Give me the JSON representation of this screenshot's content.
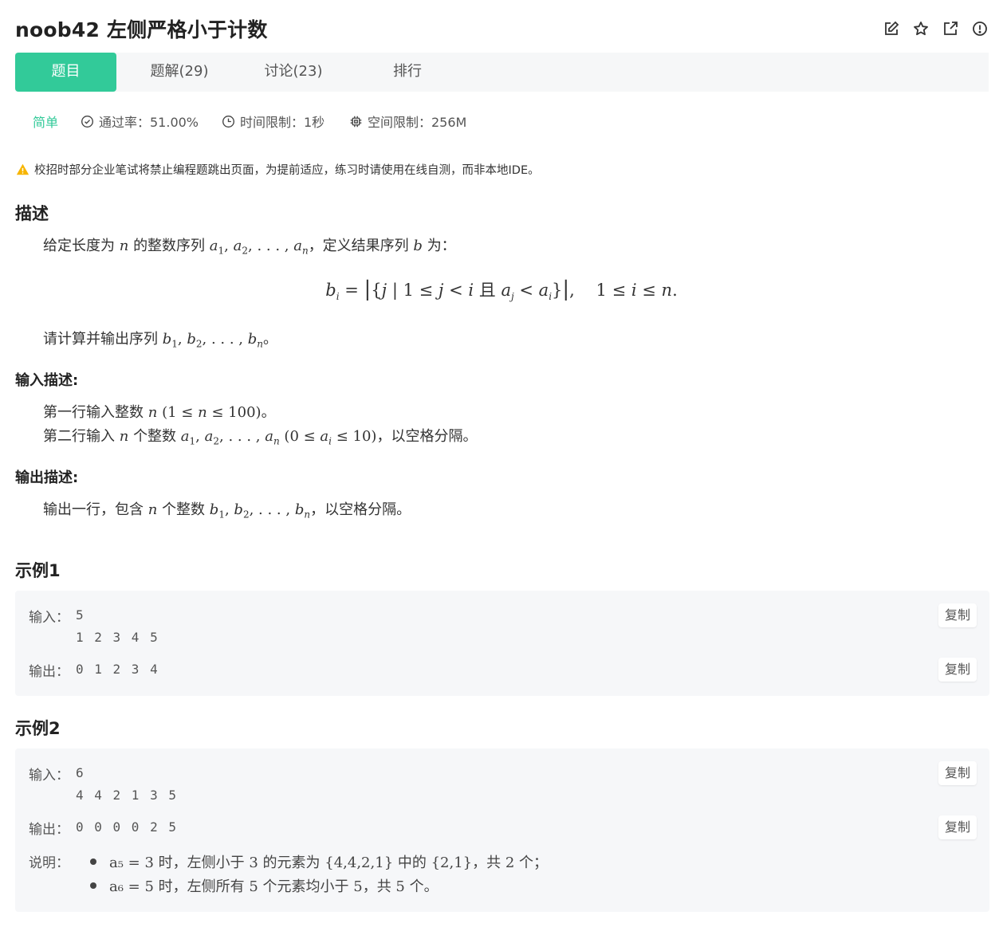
{
  "header": {
    "title": "noob42  左侧严格小于计数",
    "icons": [
      "edit-icon",
      "star-icon",
      "external-link-icon",
      "report-icon"
    ]
  },
  "tabs": [
    {
      "label": "题目",
      "active": true
    },
    {
      "label": "题解(29)"
    },
    {
      "label": "讨论(23)"
    },
    {
      "label": "排行"
    }
  ],
  "meta": {
    "difficulty": "简单",
    "pass_rate": "通过率：51.00%",
    "time_limit": "时间限制：1秒",
    "space_limit": "空间限制：256M"
  },
  "warning": "校招时部分企业笔试将禁止编程题跳出页面，为提前适应，练习时请使用在线自测，而非本地IDE。",
  "description": {
    "heading": "描述",
    "line1_pre": "给定长度为",
    "line1_mid": "的整数序列",
    "line1_post": "，定义结果序列",
    "line1_end": "为：",
    "line2_pre": "请计算并输出序列",
    "line2_post": "。"
  },
  "input_desc": {
    "heading": "输入描述:",
    "line1_pre": "第一行输入整数",
    "line1_post": "。",
    "line2_pre": "第二行输入",
    "line2_mid": "个整数",
    "line2_post": "，以空格分隔。"
  },
  "output_desc": {
    "heading": "输出描述:",
    "line_pre": "输出一行，包含",
    "line_mid": "个整数",
    "line_post": "，以空格分隔。"
  },
  "examples": [
    {
      "heading": "示例1",
      "input_label": "输入：",
      "input_lines": [
        "5",
        "1 2 3 4 5"
      ],
      "output_label": "输出：",
      "output": "0 1 2 3 4",
      "copy_label": "复制"
    },
    {
      "heading": "示例2",
      "input_label": "输入：",
      "input_lines": [
        "6",
        "4 4 2 1 3 5"
      ],
      "output_label": "输出：",
      "output": "0 0 0 0 2 5",
      "copy_label": "复制",
      "note_label": "说明：",
      "notes": [
        "a₅ = 3 时，左侧小于 3 的元素为 {4,4,2,1} 中的 {2,1}，共 2 个；",
        "a₆ = 5 时，左侧所有 5 个元素均小于 5，共 5 个。"
      ]
    }
  ]
}
